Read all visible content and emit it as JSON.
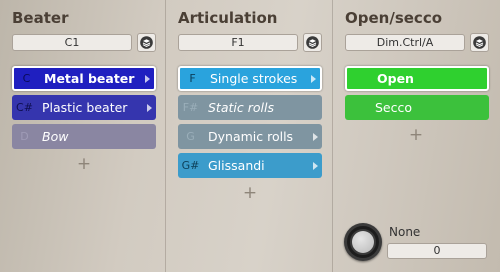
{
  "panels": [
    {
      "title": "Beater",
      "selector": "C1",
      "items": [
        {
          "key": "C",
          "label": "Metal beater",
          "color": "#1f1fc0",
          "selected": true,
          "italic": false,
          "arrow": true
        },
        {
          "key": "C#",
          "label": "Plastic beater",
          "color": "#3535ae",
          "selected": false,
          "italic": false,
          "arrow": true
        },
        {
          "key": "D",
          "label": "Bow",
          "color": "#8a86a2",
          "selected": false,
          "italic": true,
          "arrow": false
        }
      ]
    },
    {
      "title": "Articulation",
      "selector": "F1",
      "items": [
        {
          "key": "F",
          "label": "Single strokes",
          "color": "#2aa3dd",
          "selected": true,
          "italic": false,
          "arrow": true
        },
        {
          "key": "F#",
          "label": "Static rolls",
          "color": "#7f95a1",
          "selected": false,
          "italic": true,
          "arrow": false
        },
        {
          "key": "G",
          "label": "Dynamic rolls",
          "color": "#7f95a1",
          "selected": false,
          "italic": false,
          "arrow": true
        },
        {
          "key": "G#",
          "label": "Glissandi",
          "color": "#3c9ccb",
          "selected": false,
          "italic": false,
          "arrow": true
        }
      ]
    },
    {
      "title": "Open/secco",
      "selector": "Dim.Ctrl/A",
      "items": [
        {
          "key": "",
          "label": "Open",
          "color": "#2fd02f",
          "selected": true,
          "italic": false,
          "arrow": false
        },
        {
          "key": "",
          "label": "Secco",
          "color": "#3cc13c",
          "selected": false,
          "italic": false,
          "arrow": false
        }
      ]
    }
  ],
  "knob": {
    "label": "None",
    "value": "0"
  },
  "plus": "+"
}
